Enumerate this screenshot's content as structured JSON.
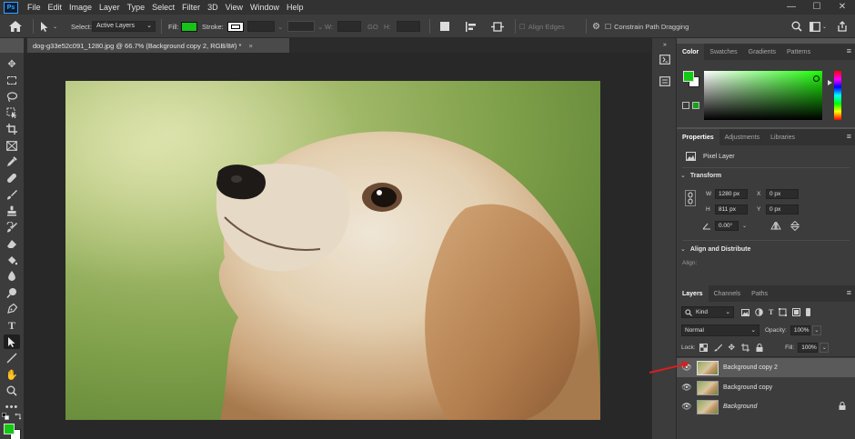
{
  "app": {
    "logo": "Ps"
  },
  "menu": [
    "File",
    "Edit",
    "Image",
    "Layer",
    "Type",
    "Select",
    "Filter",
    "3D",
    "View",
    "Window",
    "Help"
  ],
  "window_controls": {
    "minimize": "—",
    "maximize": "☐",
    "close": "✕"
  },
  "options_bar": {
    "select_label": "Select:",
    "select_value": "Active Layers",
    "fill_label": "Fill:",
    "fill_color": "#17c21a",
    "stroke_label": "Stroke:",
    "w_label": "W:",
    "go_label": "GO",
    "h_label": "H:",
    "align_edges": "Align Edges",
    "constrain_path": "Constrain Path Dragging"
  },
  "document": {
    "tab_title": "dog-g33e52c091_1280.jpg @ 66.7% (Background copy 2, RGB/8#) *",
    "close": "×"
  },
  "color_panel": {
    "tabs": [
      "Color",
      "Swatches",
      "Gradients",
      "Patterns"
    ],
    "foreground": "#13c913",
    "background": "#ffffff"
  },
  "properties_panel": {
    "tabs": [
      "Properties",
      "Adjustments",
      "Libraries"
    ],
    "layer_type": "Pixel Layer",
    "transform_title": "Transform",
    "w_label": "W",
    "w_value": "1280 px",
    "x_label": "X",
    "x_value": "0 px",
    "h_label": "H",
    "h_value": "811 px",
    "y_label": "Y",
    "y_value": "0 px",
    "angle_value": "0.00°",
    "align_title": "Align and Distribute",
    "align_label": "Align:"
  },
  "layers_panel": {
    "tabs": [
      "Layers",
      "Channels",
      "Paths"
    ],
    "filter_kind": "Kind",
    "blend_mode": "Normal",
    "opacity_label": "Opacity:",
    "opacity_value": "100%",
    "lock_label": "Lock:",
    "fill_label": "Fill:",
    "fill_value": "100%",
    "layers": [
      {
        "name": "Background copy 2",
        "selected": true
      },
      {
        "name": "Background copy",
        "selected": false
      },
      {
        "name": "Background",
        "selected": false,
        "locked": true
      }
    ]
  },
  "annotation": {
    "color": "#d81e1e"
  }
}
